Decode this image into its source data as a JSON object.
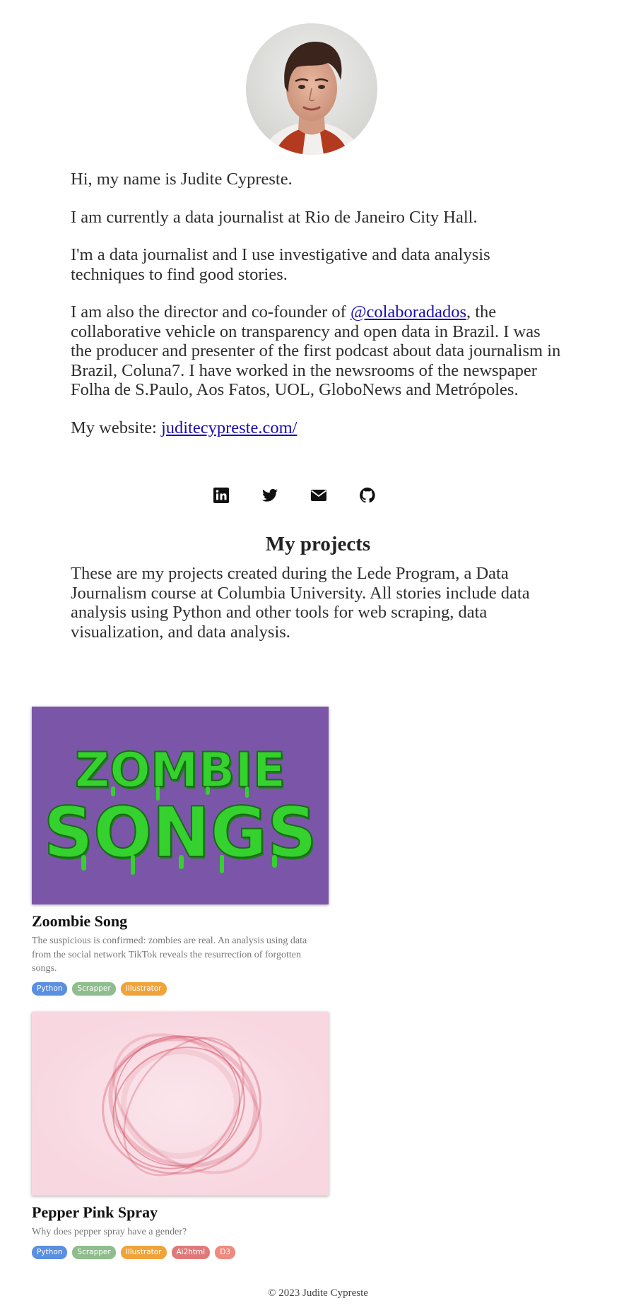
{
  "profile": {
    "greeting": "Hi, my name is Judite Cypreste.",
    "current_role": "I am currently a data journalist at Rio de Janeiro City Hall.",
    "about": "I'm a data journalist and I use investigative and data analysis techniques to find good stories.",
    "director_prefix": "I am also the director and co-founder of ",
    "director_link": "@colaboradados",
    "director_suffix": ", the collaborative vehicle on transparency and open data in Brazil. I was the producer and presenter of the first podcast about data journalism in Brazil, Coluna7. I have worked in the newsrooms of the newspaper Folha de S.Paulo, Aos Fatos, UOL, GloboNews and Metrópoles.",
    "website_label": "My website: ",
    "website_link": "juditecypreste.com/"
  },
  "socials": [
    {
      "icon": "linkedin-icon"
    },
    {
      "icon": "twitter-icon"
    },
    {
      "icon": "mail-icon"
    },
    {
      "icon": "github-icon"
    }
  ],
  "projects": {
    "title": "My projects",
    "description": "These are my projects created during the Lede Program, a Data Journalism course at Columbia University. All stories include data analysis using Python and other tools for web scraping, data visualization, and data analysis.",
    "items": [
      {
        "image_text_top": "ZOMBIE",
        "image_text_bottom": "SONGS",
        "title": "Zoombie Song",
        "description": "The suspicious is confirmed: zombies are real. An analysis using data from the social network TikTok reveals the resurrection of forgotten songs.",
        "tags": [
          "Python",
          "Scrapper",
          "Illustrator"
        ]
      },
      {
        "title": "Pepper Pink Spray",
        "description": "Why does pepper spray have a gender?",
        "tags": [
          "Python",
          "Scrapper",
          "Illustrator",
          "Ai2html",
          "D3"
        ]
      }
    ]
  },
  "tag_colors": {
    "Python": "#5b8fe0",
    "Scrapper": "#8fbd8d",
    "Illustrator": "#f0a33a",
    "Ai2html": "#e07a7a",
    "D3": "#f08a7e"
  },
  "colors": {
    "link": "#1a0dab",
    "zombie_bg": "#7b56a8",
    "zombie_text": "#35d12e",
    "pepper_bg": "#f8d7e1",
    "pepper_ring": "#d0485c"
  },
  "footer": "© 2023 Judite Cypreste"
}
